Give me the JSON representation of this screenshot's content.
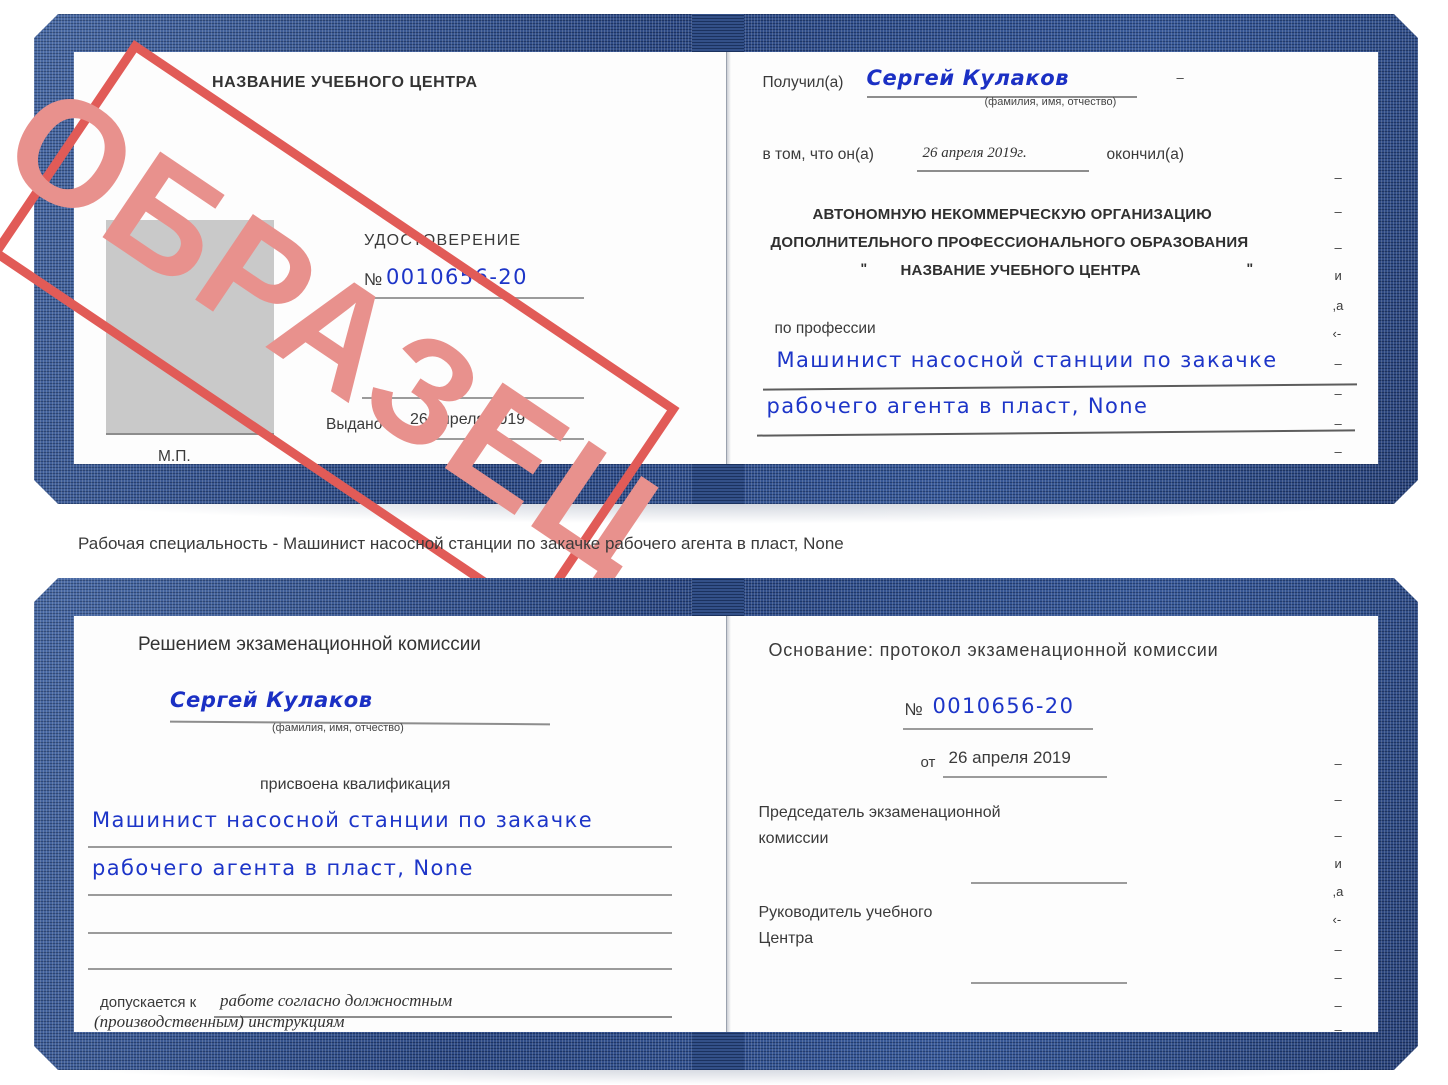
{
  "caption": "Рабочая специальность - Машинист насосной станции по закачке рабочего агента в пласт, None",
  "stamp": {
    "text": "ОБРАЗЕЦ",
    "border_color": "#e15b57",
    "text_color": "#e8918d"
  },
  "colors": {
    "cover_blue": "#2c4f96",
    "handwriting_blue": "#1d35c8",
    "photo_gray": "#c9c9c9",
    "rule_gray": "#9b9b9b"
  },
  "certificate": {
    "number": "0010656-20",
    "issue_date": "26 апреля 2019",
    "issue_date_long": "26 апреля 2019г.",
    "holder_name": "Сергей Кулаков",
    "profession": [
      "Машинист насосной станции по закачке",
      "рабочего агента в пласт, None"
    ]
  },
  "page1": {
    "center_name": "НАЗВАНИЕ УЧЕБНОГО ЦЕНТРА",
    "doc_title": "УДОСТОВЕРЕНИЕ",
    "number_symbol": "№",
    "number_value": "0010656-20",
    "issued_label": "Выдано",
    "issued_value": "26 апреля 2019",
    "seal_label": "М.П."
  },
  "page2": {
    "received_label": "Получил(а)",
    "received_value": "Сергей Кулаков",
    "fio_hint": "(фамилия, имя, отчество)",
    "in_that_label": "в том, что он(а)",
    "in_that_value": "26 апреля 2019г.",
    "finished_label": "окончил(а)",
    "org_line1": "АВТОНОМНУЮ НЕКОММЕРЧЕСКУЮ ОРГАНИЗАЦИЮ",
    "org_line2": "ДОПОЛНИТЕЛЬНОГО ПРОФЕССИОНАЛЬНОГО ОБРАЗОВАНИЯ",
    "org_quote_open": "\"",
    "org_line3": "НАЗВАНИЕ УЧЕБНОГО ЦЕНТРА",
    "org_quote_close": "\"",
    "profession_label": "по профессии",
    "profession_line1": "Машинист насосной станции по закачке",
    "profession_line2": "рабочего агента в пласт, None",
    "edge_marks": [
      "–",
      "–",
      "–",
      "и",
      ",а",
      "‹-",
      "–",
      "–",
      "–",
      "–"
    ]
  },
  "page3": {
    "title": "Решением экзаменационной комиссии",
    "name_value": "Сергей Кулаков",
    "fio_hint": "(фамилия, имя, отчество)",
    "qualification_label": "присвоена квалификация",
    "qualification_line1": "Машинист насосной станции по закачке",
    "qualification_line2": "рабочего агента в пласт, None",
    "admitted_label": "допускается к",
    "admitted_value_line1": "работе согласно должностным",
    "admitted_value_line2": "(производственным) инструкциям"
  },
  "page4": {
    "basis_label": "Основание: протокол экзаменационной комиссии",
    "number_symbol": "№",
    "number_value": "0010656-20",
    "from_label": "от",
    "from_value": "26 апреля 2019",
    "chairman_line1": "Председатель экзаменационной",
    "chairman_line2": "комиссии",
    "head_line1": "Руководитель учебного",
    "head_line2": "Центра",
    "edge_marks": [
      "–",
      "–",
      "–",
      "и",
      ",а",
      "‹-",
      "–",
      "–",
      "–",
      "–"
    ]
  }
}
